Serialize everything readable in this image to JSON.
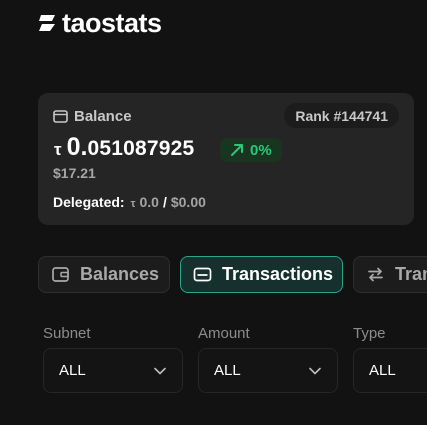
{
  "header": {
    "logo_text": "taostats",
    "logo_icon": "taostats-logo-icon"
  },
  "balance_card": {
    "title": "Balance",
    "title_icon": "wallet-icon",
    "rank": "Rank #144741",
    "tao_symbol": "τ",
    "balance_lead": "0.",
    "balance_rest": "051087925",
    "change": "0%",
    "change_icon": "arrow-up-right-icon",
    "usd_value": "$17.21",
    "delegated_label": "Delegated:",
    "delegated_tao_symbol": "τ",
    "delegated_tao": "0.0",
    "delegated_separator": "/",
    "delegated_usd": "$0.00"
  },
  "tabs": [
    {
      "label": "Balances",
      "icon": "wallet-icon",
      "active": false
    },
    {
      "label": "Transactions",
      "icon": "card-icon",
      "active": true
    },
    {
      "label": "Transfers",
      "icon": "transfer-arrows-icon",
      "active": false
    }
  ],
  "filters": [
    {
      "label": "Subnet",
      "value": "ALL"
    },
    {
      "label": "Amount",
      "value": "ALL"
    },
    {
      "label": "Type",
      "value": "ALL"
    }
  ],
  "colors": {
    "background": "#121212",
    "card": "#252525",
    "accent_green": "#27c97a",
    "active_tab_border": "#2aa588"
  }
}
